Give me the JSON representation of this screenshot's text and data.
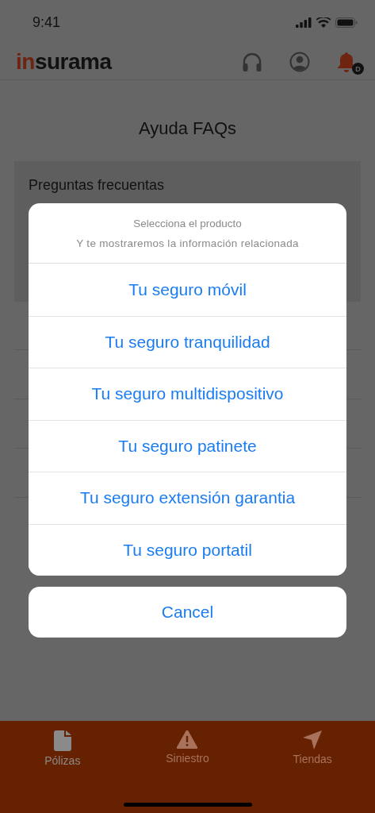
{
  "status_bar": {
    "time": "9:41"
  },
  "header": {
    "logo": {
      "accent": "in",
      "rest": "surama"
    },
    "notification_badge": "D"
  },
  "page_title": "Ayuda FAQs",
  "faq_card": {
    "title": "Preguntas frecuentas"
  },
  "action_sheet": {
    "title": "Selecciona el producto",
    "message": "Y te mostraremos la información relacionada",
    "options": [
      "Tu seguro móvil",
      "Tu seguro tranquilidad",
      "Tu seguro multidispositivo",
      "Tu seguro patinete",
      "Tu seguro extensión garantia",
      "Tu seguro portatil"
    ],
    "cancel": "Cancel"
  },
  "tab_bar": [
    {
      "label": "Pólizas",
      "kind": "document",
      "selected": true
    },
    {
      "label": "Siniestro",
      "kind": "warning",
      "selected": false
    },
    {
      "label": "Tiendas",
      "kind": "location",
      "selected": false
    }
  ]
}
